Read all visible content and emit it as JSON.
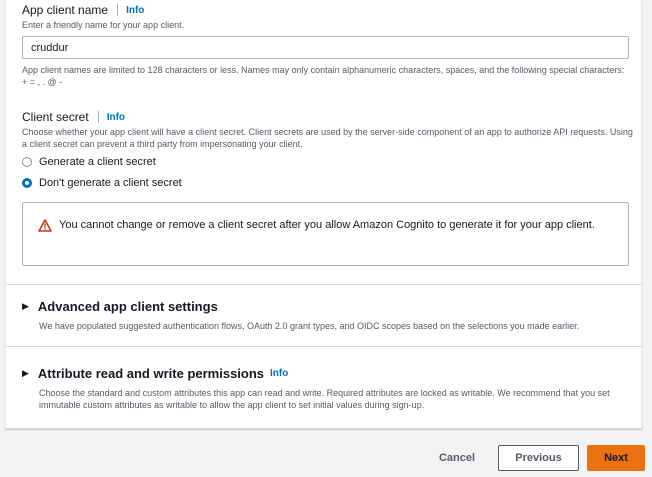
{
  "app_client_name": {
    "label": "App client name",
    "info": "Info",
    "description": "Enter a friendly name for your app client.",
    "value": "cruddur",
    "constraint": "App client names are limited to 128 characters or less. Names may only contain alphanumeric characters, spaces, and the following special characters: + = , . @ -"
  },
  "client_secret": {
    "label": "Client secret",
    "info": "Info",
    "description": "Choose whether your app client will have a client secret. Client secrets are used by the server-side component of an app to authorize API requests. Using a client secret can prevent a third party from impersonating your client.",
    "options": [
      {
        "label": "Generate a client secret",
        "selected": false
      },
      {
        "label": "Don't generate a client secret",
        "selected": true
      }
    ],
    "warning": "You cannot change or remove a client secret after you allow Amazon Cognito to generate it for your app client."
  },
  "advanced": {
    "title": "Advanced app client settings",
    "description": "We have populated suggested authentication flows, OAuth 2.0 grant types, and OIDC scopes based on the selections you made earlier."
  },
  "attributes": {
    "title": "Attribute read and write permissions",
    "info": "Info",
    "description": "Choose the standard and custom attributes this app can read and write. Required attributes are locked as writable. We recommend that you set immutable custom attributes as writable to allow the app client to set initial values during sign-up."
  },
  "footer": {
    "cancel": "Cancel",
    "previous": "Previous",
    "next": "Next"
  },
  "colors": {
    "accent": "#ec7211",
    "link": "#0073bb",
    "warning": "#d13212"
  },
  "icons": {
    "warning": "warning-triangle-icon",
    "caret": "caret-right-icon"
  }
}
